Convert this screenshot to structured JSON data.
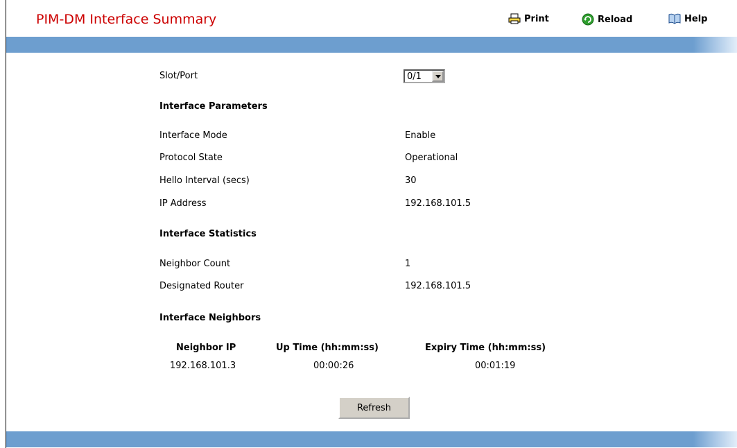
{
  "header": {
    "title": "PIM-DM Interface Summary",
    "print_label": "Print",
    "reload_label": "Reload",
    "help_label": "Help"
  },
  "slot_port": {
    "label": "Slot/Port",
    "selected": "0/1"
  },
  "interface_parameters": {
    "heading": "Interface Parameters",
    "rows": [
      {
        "label": "Interface Mode",
        "value": "Enable"
      },
      {
        "label": "Protocol State",
        "value": "Operational"
      },
      {
        "label": "Hello Interval (secs)",
        "value": "30"
      },
      {
        "label": "IP Address",
        "value": "192.168.101.5"
      }
    ]
  },
  "interface_statistics": {
    "heading": "Interface Statistics",
    "rows": [
      {
        "label": "Neighbor Count",
        "value": "1"
      },
      {
        "label": "Designated Router",
        "value": "192.168.101.5"
      }
    ]
  },
  "interface_neighbors": {
    "heading": "Interface Neighbors",
    "columns": [
      "Neighbor IP",
      "Up Time (hh:mm:ss)",
      "Expiry Time (hh:mm:ss)"
    ],
    "rows": [
      [
        "192.168.101.3",
        "00:00:26",
        "00:01:19"
      ]
    ]
  },
  "refresh_label": "Refresh",
  "colors": {
    "title": "#cc0000",
    "bar": "#6d9ecf"
  }
}
